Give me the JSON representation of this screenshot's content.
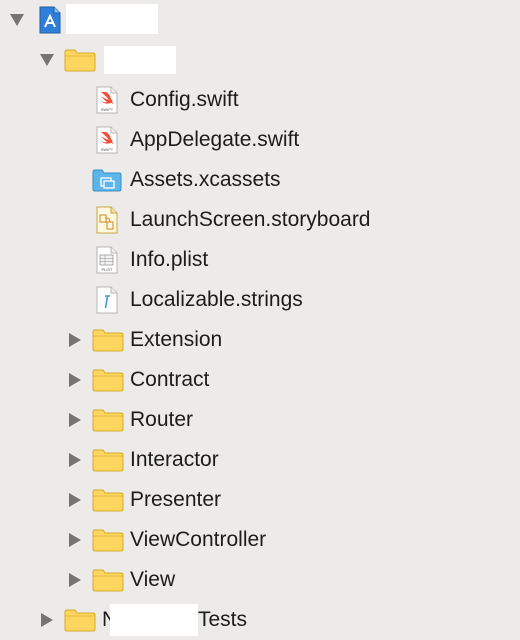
{
  "navigator": {
    "project": {
      "name": "",
      "expanded": true,
      "icon": "xcode-project-icon"
    },
    "app_group": {
      "name": "",
      "expanded": true,
      "icon": "folder-icon",
      "files": [
        {
          "name": "Config.swift",
          "icon": "swift-file-icon"
        },
        {
          "name": "AppDelegate.swift",
          "icon": "swift-file-icon"
        },
        {
          "name": "Assets.xcassets",
          "icon": "asset-catalog-icon"
        },
        {
          "name": "LaunchScreen.storyboard",
          "icon": "storyboard-icon"
        },
        {
          "name": "Info.plist",
          "icon": "plist-file-icon"
        },
        {
          "name": "Localizable.strings",
          "icon": "strings-file-icon"
        }
      ],
      "folders": [
        {
          "name": "Extension",
          "expanded": false,
          "icon": "folder-icon"
        },
        {
          "name": "Contract",
          "expanded": false,
          "icon": "folder-icon"
        },
        {
          "name": "Router",
          "expanded": false,
          "icon": "folder-icon"
        },
        {
          "name": "Interactor",
          "expanded": false,
          "icon": "folder-icon"
        },
        {
          "name": "Presenter",
          "expanded": false,
          "icon": "folder-icon"
        },
        {
          "name": "ViewController",
          "expanded": false,
          "icon": "folder-icon"
        },
        {
          "name": "View",
          "expanded": false,
          "icon": "folder-icon"
        }
      ]
    },
    "tests_group": {
      "name_prefix": "N",
      "name_suffix": "Tests",
      "expanded": false,
      "icon": "folder-icon"
    }
  },
  "colors": {
    "background": "#ecebea",
    "folder_fill": "#fdd65f",
    "folder_border": "#d9a92e",
    "swift_orange": "#f05138",
    "asset_blue": "#5db5e9",
    "disclosure_gray": "#747474"
  }
}
